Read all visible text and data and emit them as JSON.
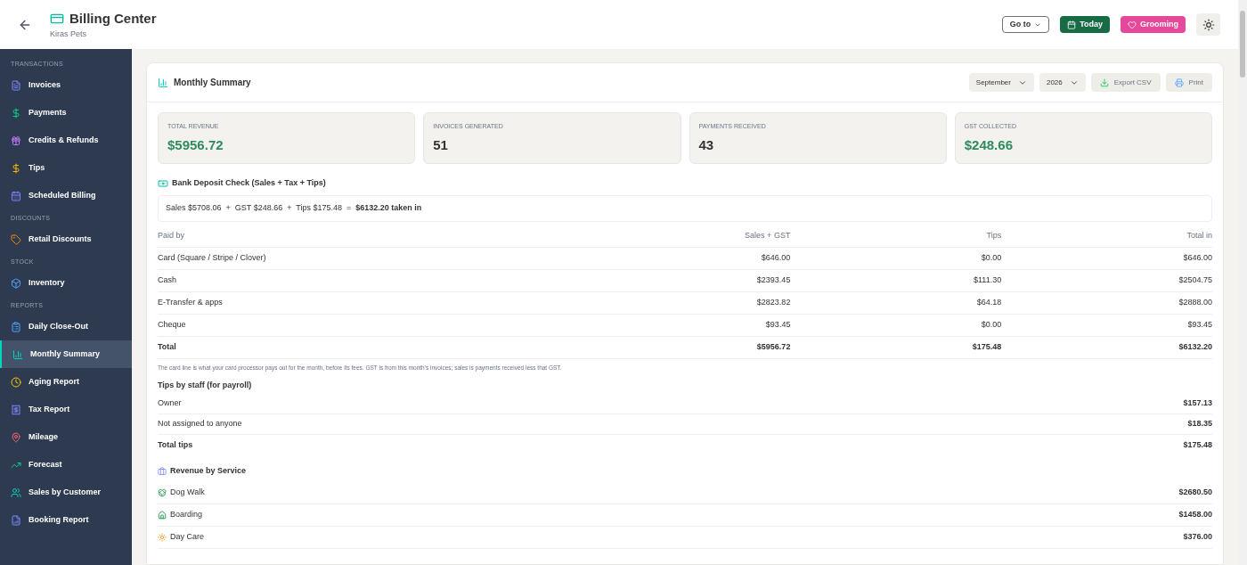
{
  "header": {
    "title": "Billing Center",
    "subtitle": "Kiras Pets",
    "goto_button": "Go to",
    "today_button": "Today",
    "grooming_button": "Grooming"
  },
  "sidebar": {
    "sections": [
      {
        "heading": "TRANSACTIONS",
        "items": [
          {
            "label": "Invoices",
            "selected": false
          },
          {
            "label": "Payments",
            "selected": false
          },
          {
            "label": "Credits & Refunds",
            "selected": false
          },
          {
            "label": "Tips",
            "selected": false
          },
          {
            "label": "Scheduled Billing",
            "selected": false
          }
        ]
      },
      {
        "heading": "DISCOUNTS",
        "items": [
          {
            "label": "Retail Discounts",
            "selected": false
          }
        ]
      },
      {
        "heading": "STOCK",
        "items": [
          {
            "label": "Inventory",
            "selected": false
          }
        ]
      },
      {
        "heading": "REPORTS",
        "items": [
          {
            "label": "Daily Close-Out",
            "selected": false
          },
          {
            "label": "Monthly Summary",
            "selected": true
          },
          {
            "label": "Aging Report",
            "selected": false
          },
          {
            "label": "Tax Report",
            "selected": false
          },
          {
            "label": "Mileage",
            "selected": false
          },
          {
            "label": "Forecast",
            "selected": false
          },
          {
            "label": "Sales by Customer",
            "selected": false
          },
          {
            "label": "Booking Report",
            "selected": false
          }
        ]
      }
    ]
  },
  "panel": {
    "title": "Monthly Summary",
    "month": "September",
    "year": "2026",
    "export_button": "Export CSV",
    "print_button": "Print",
    "stats": [
      {
        "label": "TOTAL REVENUE",
        "value": "$5956.72",
        "accent": true
      },
      {
        "label": "INVOICES GENERATED",
        "value": "51",
        "accent": false
      },
      {
        "label": "PAYMENTS RECEIVED",
        "value": "43",
        "accent": false
      },
      {
        "label": "GST COLLECTED",
        "value": "$248.66",
        "accent": true
      }
    ],
    "deposit": {
      "title": "Bank Deposit Check (Sales + Tax + Tips)",
      "equation": "Sales $5708.06  +  GST $248.66  +  Tips $175.48  =  **$6132.20 taken in**"
    },
    "paid_table": {
      "columns": [
        "Paid by",
        "Sales + GST",
        "Tips",
        "Total in"
      ],
      "rows": [
        {
          "kind": "normal",
          "cells": [
            "Card (Square / Stripe / Clover)",
            "$646.00",
            "$0.00",
            "$646.00"
          ]
        },
        {
          "kind": "normal",
          "cells": [
            "Cash",
            "$2393.45",
            "$111.30",
            "$2504.75"
          ]
        },
        {
          "kind": "normal",
          "cells": [
            "E-Transfer & apps",
            "$2823.82",
            "$64.18",
            "$2888.00"
          ]
        },
        {
          "kind": "normal",
          "cells": [
            "Cheque",
            "$93.45",
            "$0.00",
            "$93.45"
          ]
        },
        {
          "kind": "total",
          "cells": [
            "Total",
            "$5956.72",
            "$175.48",
            "$6132.20"
          ]
        }
      ]
    },
    "note": "The card line is what your card processor pays out for the month, before its fees. GST is from this month's invoices; sales is payments received less that GST.",
    "tips": {
      "title": "Tips by staff (for payroll)",
      "rows": [
        {
          "kind": "normal",
          "name": "Owner",
          "amount": "$157.13"
        },
        {
          "kind": "normal",
          "name": "Not assigned to anyone",
          "amount": "$18.35"
        },
        {
          "kind": "total",
          "name": "Total tips",
          "amount": "$175.48"
        }
      ]
    },
    "services": {
      "title": "Revenue by Service",
      "rows": [
        {
          "name": "Dog Walk",
          "amount": "$2680.50"
        },
        {
          "name": "Boarding",
          "amount": "$1458.00"
        },
        {
          "name": "Day Care",
          "amount": "$376.00"
        }
      ]
    }
  }
}
